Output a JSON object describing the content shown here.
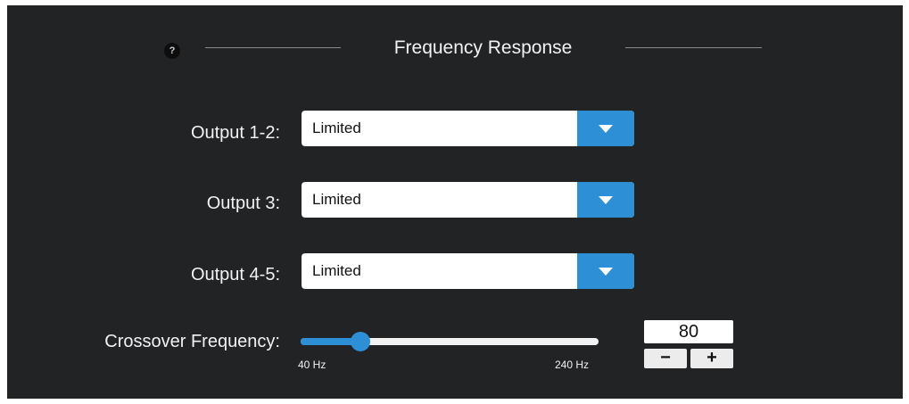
{
  "header": {
    "help_label": "?",
    "title": "Frequency Response"
  },
  "outputs": [
    {
      "label": "Output 1-2:",
      "value": "Limited"
    },
    {
      "label": "Output 3:",
      "value": "Limited"
    },
    {
      "label": "Output 4-5:",
      "value": "Limited"
    }
  ],
  "crossover": {
    "label": "Crossover Frequency:",
    "min_label": "40 Hz",
    "max_label": "240 Hz",
    "min": 40,
    "max": 240,
    "value": "80",
    "minus_label": "−",
    "plus_label": "+"
  },
  "colors": {
    "panel_bg": "#222325",
    "accent": "#2d8fd5",
    "text": "#f2f2f2"
  },
  "icons": {
    "help": "help-circle-icon",
    "dropdown": "chevron-down-icon"
  }
}
